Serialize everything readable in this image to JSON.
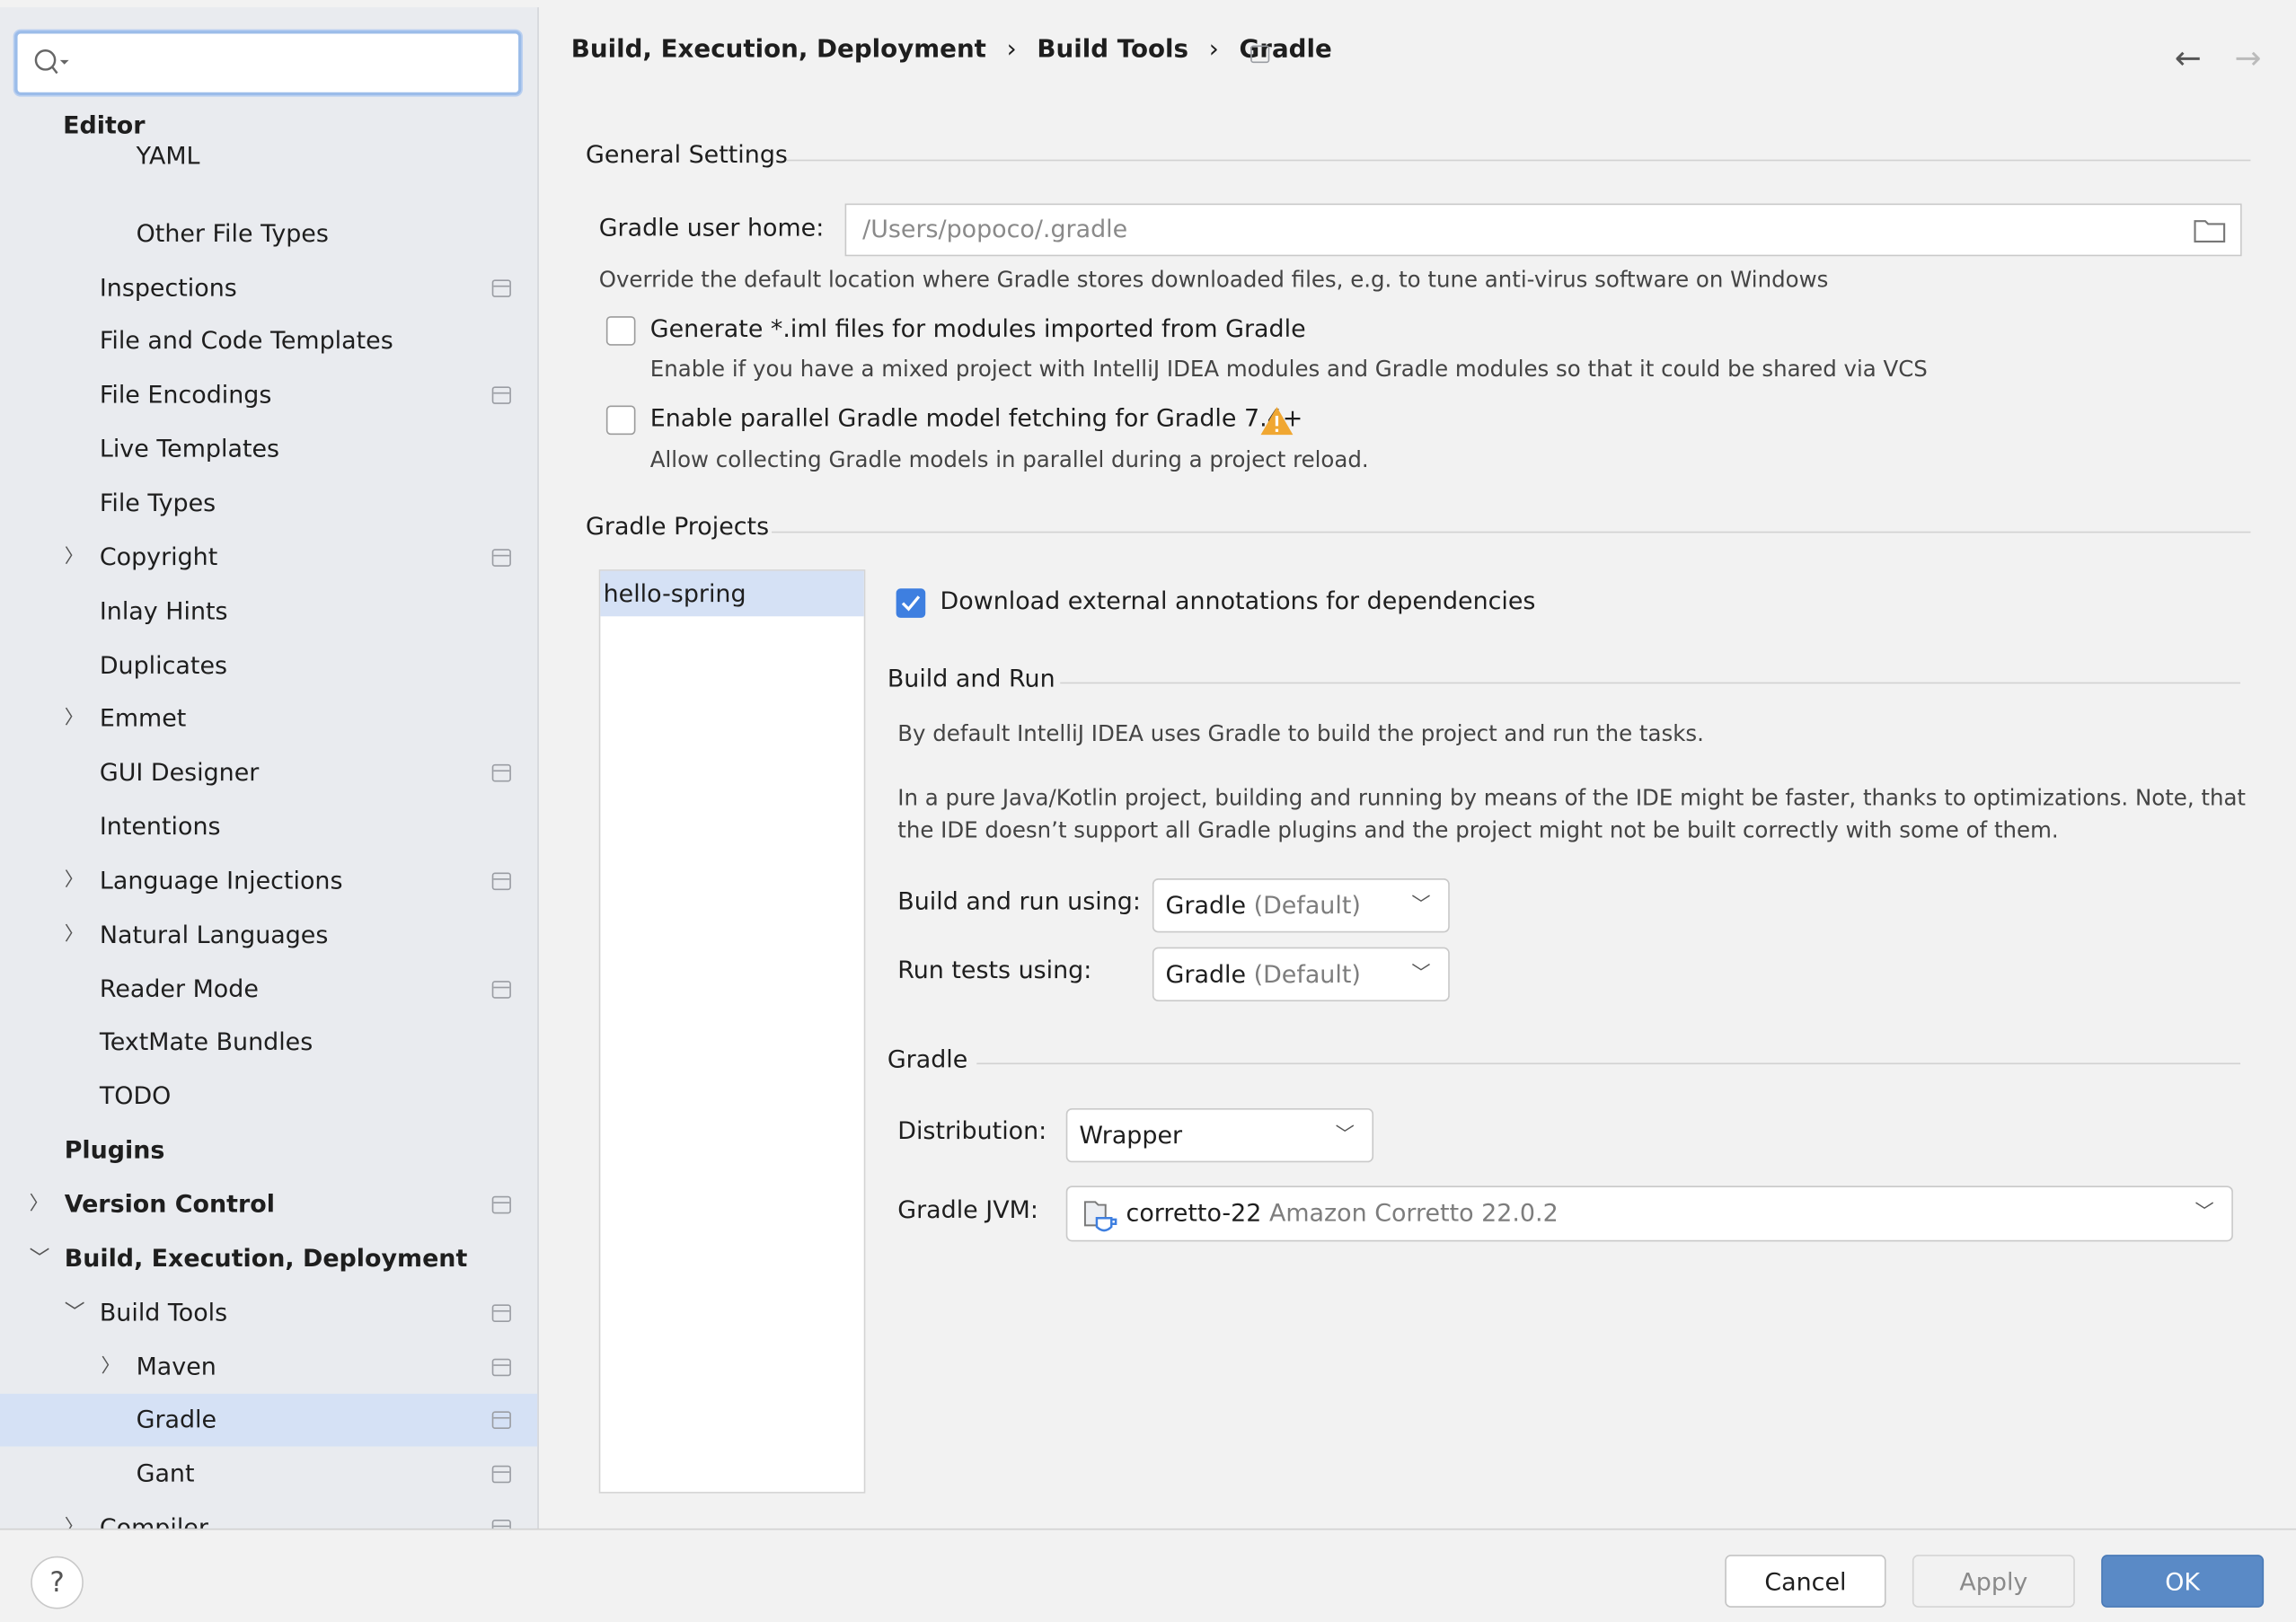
{
  "search": {
    "placeholder": "",
    "icon": "search-icon"
  },
  "sidebar": {
    "items": [
      {
        "label": "Editor",
        "level": 0,
        "bold": true,
        "chevron": "",
        "pin": false,
        "partial": false
      },
      {
        "label": "YAML",
        "level": 2,
        "bold": false,
        "chevron": "",
        "pin": false,
        "partial": true
      },
      {
        "label": "Other File Types",
        "level": 2,
        "bold": false,
        "chevron": "",
        "pin": false
      },
      {
        "label": "Inspections",
        "level": 1,
        "bold": false,
        "chevron": "",
        "pin": true
      },
      {
        "label": "File and Code Templates",
        "level": 1,
        "bold": false,
        "chevron": "",
        "pin": false
      },
      {
        "label": "File Encodings",
        "level": 1,
        "bold": false,
        "chevron": "",
        "pin": true
      },
      {
        "label": "Live Templates",
        "level": 1,
        "bold": false,
        "chevron": "",
        "pin": false
      },
      {
        "label": "File Types",
        "level": 1,
        "bold": false,
        "chevron": "",
        "pin": false
      },
      {
        "label": "Copyright",
        "level": 1,
        "bold": false,
        "chevron": "right",
        "pin": true
      },
      {
        "label": "Inlay Hints",
        "level": 1,
        "bold": false,
        "chevron": "",
        "pin": false
      },
      {
        "label": "Duplicates",
        "level": 1,
        "bold": false,
        "chevron": "",
        "pin": false
      },
      {
        "label": "Emmet",
        "level": 1,
        "bold": false,
        "chevron": "right",
        "pin": false
      },
      {
        "label": "GUI Designer",
        "level": 1,
        "bold": false,
        "chevron": "",
        "pin": true
      },
      {
        "label": "Intentions",
        "level": 1,
        "bold": false,
        "chevron": "",
        "pin": false
      },
      {
        "label": "Language Injections",
        "level": 1,
        "bold": false,
        "chevron": "right",
        "pin": true
      },
      {
        "label": "Natural Languages",
        "level": 1,
        "bold": false,
        "chevron": "right",
        "pin": false
      },
      {
        "label": "Reader Mode",
        "level": 1,
        "bold": false,
        "chevron": "",
        "pin": true
      },
      {
        "label": "TextMate Bundles",
        "level": 1,
        "bold": false,
        "chevron": "",
        "pin": false
      },
      {
        "label": "TODO",
        "level": 1,
        "bold": false,
        "chevron": "",
        "pin": false
      },
      {
        "label": "Plugins",
        "level": 0,
        "bold": true,
        "chevron": "",
        "pin": false
      },
      {
        "label": "Version Control",
        "level": 0,
        "bold": true,
        "chevron": "right",
        "pin": true
      },
      {
        "label": "Build, Execution, Deployment",
        "level": 0,
        "bold": true,
        "chevron": "down",
        "pin": false
      },
      {
        "label": "Build Tools",
        "level": 1,
        "bold": false,
        "chevron": "down",
        "pin": true
      },
      {
        "label": "Maven",
        "level": 2,
        "bold": false,
        "chevron": "right",
        "pin": true
      },
      {
        "label": "Gradle",
        "level": 2,
        "bold": false,
        "chevron": "",
        "pin": true,
        "selected": true
      },
      {
        "label": "Gant",
        "level": 2,
        "bold": false,
        "chevron": "",
        "pin": true
      },
      {
        "label": "Compiler",
        "level": 1,
        "bold": false,
        "chevron": "right",
        "pin": true
      }
    ]
  },
  "breadcrumb": [
    "Build, Execution, Deployment",
    "Build Tools",
    "Gradle"
  ],
  "general": {
    "title": "General Settings",
    "user_home_label": "Gradle user home:",
    "user_home_placeholder": "/Users/popoco/.gradle",
    "user_home_hint": "Override the default location where Gradle stores downloaded files, e.g. to tune anti-virus software on Windows",
    "generate_iml_label": "Generate *.iml files for modules imported from Gradle",
    "generate_iml_checked": false,
    "generate_iml_hint": "Enable if you have a mixed project with IntelliJ IDEA modules and Gradle modules so that it could be shared via VCS",
    "parallel_label": "Enable parallel Gradle model fetching for Gradle 7.4+",
    "parallel_checked": false,
    "parallel_hint": "Allow collecting Gradle models in parallel during a project reload."
  },
  "projects": {
    "title": "Gradle Projects",
    "list": [
      "hello-spring"
    ],
    "download_annotations_label": "Download external annotations for dependencies",
    "download_annotations_checked": true,
    "build_run": {
      "title": "Build and Run",
      "desc1": "By default IntelliJ IDEA uses Gradle to build the project and run the tasks.",
      "desc2a": "In a pure Java/Kotlin project, building and running by means of the IDE might be faster, thanks to optimizations. Note, that",
      "desc2b": "the IDE doesn’t support all Gradle plugins and the project might not be built correctly with some of them.",
      "build_using_label": "Build and run using:",
      "build_using_value": "Gradle",
      "build_using_suffix": "(Default)",
      "tests_using_label": "Run tests using:",
      "tests_using_value": "Gradle",
      "tests_using_suffix": "(Default)"
    },
    "gradle": {
      "title": "Gradle",
      "distribution_label": "Distribution:",
      "distribution_value": "Wrapper",
      "jvm_label": "Gradle JVM:",
      "jvm_value": "corretto-22",
      "jvm_detail": "Amazon Corretto 22.0.2"
    }
  },
  "footer": {
    "help": "?",
    "cancel": "Cancel",
    "apply": "Apply",
    "ok": "OK"
  },
  "colors": {
    "accent": "#3e7fe0",
    "ok_button": "#5a8ac6",
    "selection": "#d5e1f5",
    "warning": "#f0a732"
  }
}
